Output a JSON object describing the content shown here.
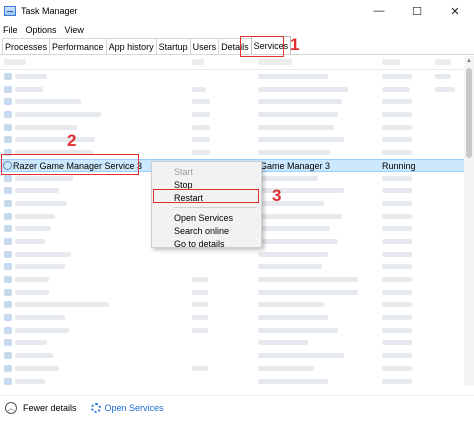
{
  "window": {
    "title": "Task Manager",
    "controls": {
      "minimize": "—",
      "maximize": "☐",
      "close": "✕"
    }
  },
  "menu": [
    "File",
    "Options",
    "View"
  ],
  "tabs": [
    "Processes",
    "Performance",
    "App history",
    "Startup",
    "Users",
    "Details",
    "Services"
  ],
  "active_tab": "Services",
  "annotations": {
    "one": "1",
    "two": "2",
    "three": "3"
  },
  "accent_color": "#e03030",
  "selected_row": {
    "name": "Razer Game Manager Service 3",
    "description_fragment": "Game Manager 3",
    "status": "Running",
    "icon": "gear-icon"
  },
  "context_menu": {
    "start": "Start",
    "stop": "Stop",
    "restart": "Restart",
    "open_services": "Open Services",
    "search_online": "Search online",
    "go_to_details": "Go to details"
  },
  "footer": {
    "fewer_details": "Fewer details",
    "open_services": "Open Services"
  }
}
